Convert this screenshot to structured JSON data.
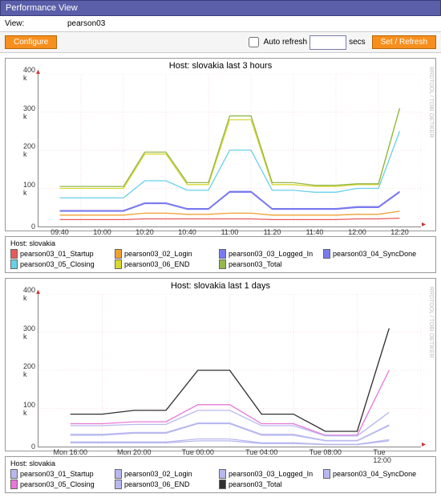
{
  "titlebar": "Performance View",
  "viewrow": {
    "label": "View:",
    "value": "pearson03"
  },
  "buttons": {
    "configure": "Configure",
    "auto_refresh_label": "Auto refresh",
    "secs": "secs",
    "setrefresh": "Set / Refresh"
  },
  "charts": [
    {
      "title": "Host: slovakia last 3 hours",
      "sidetext": "RRDTOOL / TOBI OETIKER",
      "ymax": 400,
      "yticks": [
        0,
        100,
        200,
        300,
        400
      ],
      "ylabels": [
        "0",
        "100 k",
        "200 k",
        "300 k",
        "400 k"
      ],
      "xticks": [
        "09:40",
        "10:00",
        "10:20",
        "10:40",
        "11:00",
        "11:20",
        "11:40",
        "12:00",
        "12:20"
      ],
      "legend_host": "Host: slovakia",
      "legend": [
        {
          "c": "#e85a5a",
          "t": "pearson03_01_Startup"
        },
        {
          "c": "#f0a030",
          "t": "pearson03_02_Login"
        },
        {
          "c": "#7a7af0",
          "t": "pearson03_03_Logged_In"
        },
        {
          "c": "#7a7af0",
          "t": "pearson03_04_SyncDone"
        },
        {
          "c": "#6ad0e8",
          "t": "pearson03_05_Closing"
        },
        {
          "c": "#d8d830",
          "t": "pearson03_06_END"
        },
        {
          "c": "#94b84d",
          "t": "pearson03_Total"
        }
      ]
    },
    {
      "title": "Host: slovakia last 1 days",
      "sidetext": "RRDTOOL / TOBI OETIKER",
      "ymax": 400,
      "yticks": [
        0,
        100,
        200,
        300,
        400
      ],
      "ylabels": [
        "0",
        "100 k",
        "200 k",
        "300 k",
        "400 k"
      ],
      "xticks": [
        "Mon 16:00",
        "Mon 20:00",
        "Tue 00:00",
        "Tue 04:00",
        "Tue 08:00",
        "Tue 12:00"
      ],
      "legend_host": "Host: slovakia",
      "legend": [
        {
          "c": "#b8b8f0",
          "t": "pearson03_01_Startup"
        },
        {
          "c": "#b8b8f0",
          "t": "pearson03_02_Login"
        },
        {
          "c": "#b8b8f0",
          "t": "pearson03_03_Logged_In"
        },
        {
          "c": "#b8b8f0",
          "t": "pearson03_04_SyncDone"
        },
        {
          "c": "#e878d8",
          "t": "pearson03_05_Closing"
        },
        {
          "c": "#b8b8f0",
          "t": "pearson03_06_END"
        },
        {
          "c": "#303030",
          "t": "pearson03_Total"
        }
      ]
    }
  ],
  "chart_data": [
    {
      "type": "line",
      "title": "Host: slovakia last 3 hours",
      "ylabel": "k",
      "ylim": [
        0,
        400
      ],
      "x": [
        "09:40",
        "10:00",
        "10:20",
        "10:40",
        "11:00",
        "11:20",
        "11:40",
        "12:00",
        "12:20"
      ],
      "series": [
        {
          "name": "pearson03_01_Startup",
          "color": "#e85a5a",
          "values": [
            18,
            18,
            20,
            20,
            20,
            18,
            18,
            20,
            22
          ]
        },
        {
          "name": "pearson03_02_Login",
          "color": "#f0a030",
          "values": [
            30,
            30,
            35,
            32,
            35,
            30,
            30,
            32,
            40
          ]
        },
        {
          "name": "pearson03_03_Logged_In",
          "color": "#7a7af0",
          "values": [
            40,
            40,
            60,
            45,
            90,
            45,
            45,
            50,
            90
          ]
        },
        {
          "name": "pearson03_04_SyncDone",
          "color": "#7a7af0",
          "values": [
            42,
            42,
            62,
            47,
            92,
            47,
            47,
            52,
            92
          ]
        },
        {
          "name": "pearson03_05_Closing",
          "color": "#6ad0e8",
          "values": [
            75,
            75,
            120,
            95,
            200,
            95,
            90,
            100,
            250
          ]
        },
        {
          "name": "pearson03_06_END",
          "color": "#d8d830",
          "values": [
            100,
            100,
            190,
            110,
            280,
            110,
            105,
            110,
            310
          ]
        },
        {
          "name": "pearson03_Total",
          "color": "#94b84d",
          "values": [
            105,
            105,
            195,
            115,
            290,
            115,
            108,
            112,
            310
          ]
        }
      ]
    },
    {
      "type": "line",
      "title": "Host: slovakia last 1 days",
      "ylabel": "k",
      "ylim": [
        0,
        400
      ],
      "x": [
        "Mon 16:00",
        "Mon 20:00",
        "Tue 00:00",
        "Tue 04:00",
        "Tue 08:00",
        "Tue 12:00"
      ],
      "series": [
        {
          "name": "pearson03_01_Startup",
          "color": "#b8b8f0",
          "values": [
            10,
            10,
            15,
            8,
            5,
            15
          ]
        },
        {
          "name": "pearson03_02_Login",
          "color": "#b8b8f0",
          "values": [
            12,
            12,
            20,
            10,
            6,
            18
          ]
        },
        {
          "name": "pearson03_03_Logged_In",
          "color": "#b8b8f0",
          "values": [
            30,
            35,
            60,
            30,
            15,
            55
          ]
        },
        {
          "name": "pearson03_04_SyncDone",
          "color": "#b8b8f0",
          "values": [
            32,
            37,
            62,
            32,
            16,
            57
          ]
        },
        {
          "name": "pearson03_05_Closing",
          "color": "#e878d8",
          "values": [
            60,
            65,
            110,
            60,
            30,
            200
          ]
        },
        {
          "name": "pearson03_06_END",
          "color": "#b8b8f0",
          "values": [
            55,
            58,
            95,
            55,
            28,
            90
          ]
        },
        {
          "name": "pearson03_Total",
          "color": "#303030",
          "values": [
            85,
            95,
            200,
            85,
            40,
            310
          ]
        }
      ]
    }
  ]
}
